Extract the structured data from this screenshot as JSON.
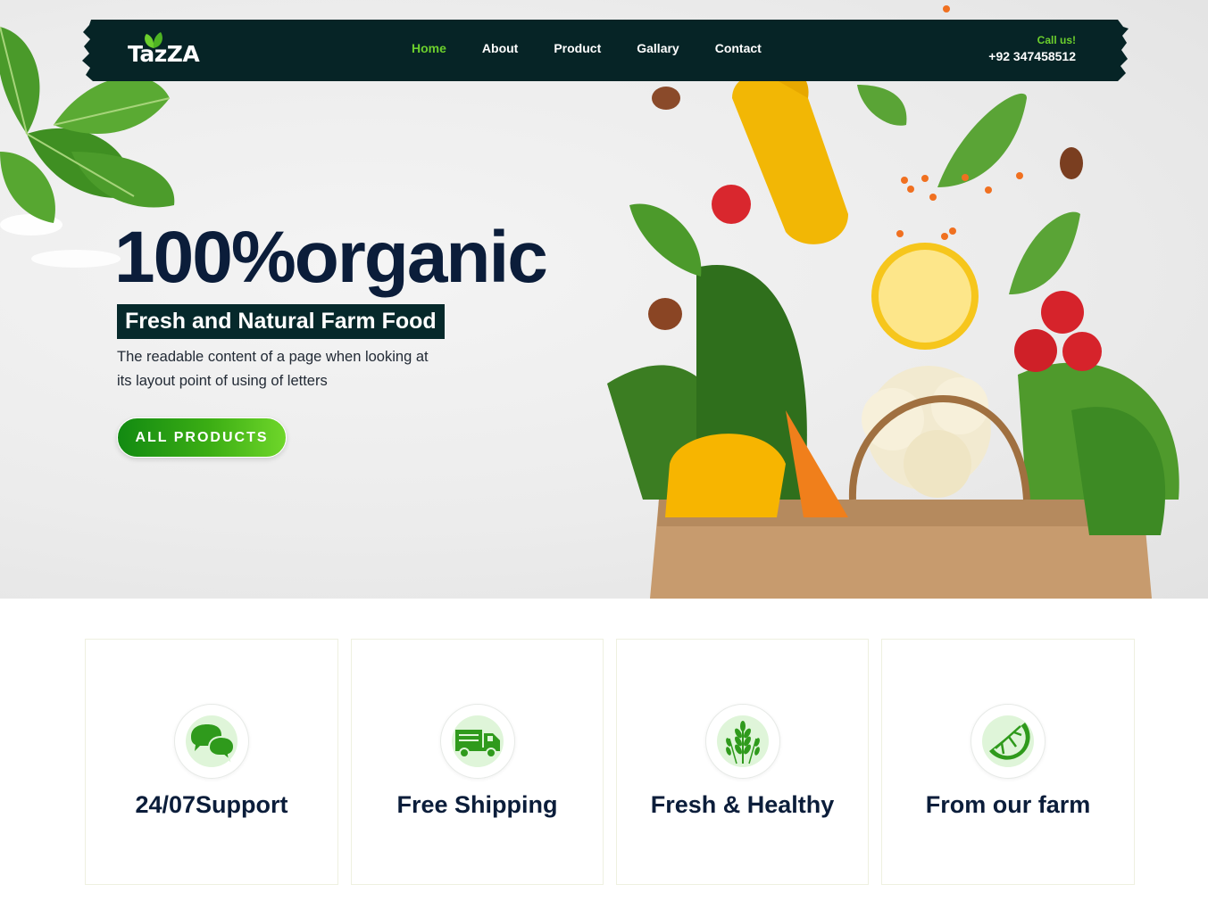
{
  "brand": {
    "name": "TazZA"
  },
  "nav": {
    "items": [
      {
        "label": "Home",
        "active": true
      },
      {
        "label": "About",
        "active": false
      },
      {
        "label": "Product",
        "active": false
      },
      {
        "label": "Gallary",
        "active": false
      },
      {
        "label": "Contact",
        "active": false
      }
    ],
    "call_label": "Call us!",
    "call_number": "+92 347458512"
  },
  "hero": {
    "headline": "100%organic",
    "tagline": "Fresh and Natural Farm Food",
    "description": "The readable content of a page when looking at its layout point of using of letters",
    "cta_label": "ALL PRODUCTS"
  },
  "features": [
    {
      "title": "24/07Support",
      "icon": "chat-bubbles-icon"
    },
    {
      "title": "Free Shipping",
      "icon": "delivery-truck-icon"
    },
    {
      "title": "Fresh & Healthy",
      "icon": "wheat-icon"
    },
    {
      "title": "From our farm",
      "icon": "lime-slice-icon"
    }
  ],
  "colors": {
    "nav_bg": "#062426",
    "accent_green": "#6ccf2d",
    "heading_navy": "#0b1d3a",
    "icon_green": "#2f9a1c",
    "icon_bg": "#dff5d9"
  }
}
